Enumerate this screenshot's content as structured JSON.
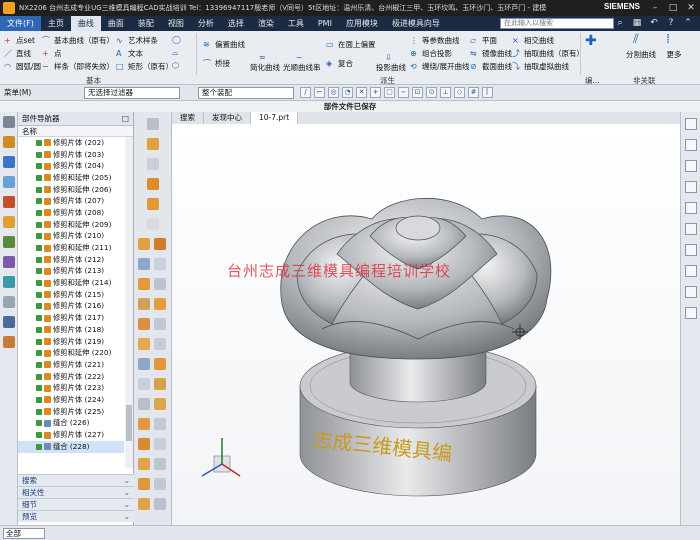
{
  "window": {
    "title": "NX2206 台州志成专业UG三维模具编程CAD实战培训 Tel：13396947117殷老师（V同号）5t区地址：温州乐清、台州椒江三甲、玉环坎鸣、玉环沙门、玉环芦门 - 建模",
    "brand": "SIEMENS"
  },
  "menu": {
    "tabs": [
      "文件(F)",
      "主页",
      "曲线",
      "曲面",
      "装配",
      "视图",
      "分析",
      "选择",
      "渲染",
      "工具",
      "PMI",
      "应用模块",
      "极进模具向导"
    ],
    "active_tab": "曲线",
    "search_placeholder": "在此输入以搜索"
  },
  "ribbon": {
    "basic": {
      "items": [
        "点set",
        "直线",
        "圆弧/圆",
        "基本曲线（原有）",
        "点",
        "样条（即将失效）",
        "艺术样条",
        "文本",
        "矩形（原有）"
      ],
      "label": "基本"
    },
    "derived": {
      "items": [
        "偏置曲线",
        "桥接",
        "简化曲线",
        "光顺曲线串",
        "在面上偏置",
        "复合",
        "投影曲线",
        "等参数曲线",
        "组合投影",
        "缠绕/展开曲线",
        "平面",
        "镜像曲线",
        "截面曲线",
        "相交曲线",
        "抽取曲线（原有）",
        "抽取虚拟曲线"
      ],
      "label": "派生"
    },
    "edit": {
      "items": [
        "分割曲线"
      ],
      "label": "编..."
    },
    "nonassoc": {
      "items": [
        "更多"
      ],
      "label": "非关联"
    }
  },
  "toolbar": {
    "menu_label": "菜单(M)",
    "filter_value": "无选择过滤器",
    "assembly_value": "整个装配"
  },
  "status_message": "部件文件已保存",
  "navigator": {
    "title": "部件导航器",
    "column": "名称",
    "rows": [
      "修剪片体 (202)",
      "修剪片体 (203)",
      "修剪片体 (204)",
      "修剪和延伸 (205)",
      "修剪和延伸 (206)",
      "修剪片体 (207)",
      "修剪片体 (208)",
      "修剪和延伸 (209)",
      "修剪片体 (210)",
      "修剪和延伸 (211)",
      "修剪片体 (212)",
      "修剪片体 (213)",
      "修剪和延伸 (214)",
      "修剪片体 (215)",
      "修剪片体 (216)",
      "修剪片体 (217)",
      "修剪片体 (218)",
      "修剪片体 (219)",
      "修剪和延伸 (220)",
      "修剪片体 (221)",
      "修剪片体 (222)",
      "修剪片体 (223)",
      "修剪片体 (224)",
      "修剪片体 (225)",
      "缝合 (226)",
      "修剪片体 (227)",
      "缝合 (228)"
    ],
    "panels": [
      "搜索",
      "相关性",
      "细节",
      "预览"
    ]
  },
  "graphics_tabs": [
    "搜索",
    "发现中心",
    "10-7.prt"
  ],
  "graphics_active_tab": "10-7.prt",
  "watermark": "台州志成三维模具编程培训学校",
  "engraving": "志成三维模具编",
  "bottom": {
    "scope_value": "全部"
  }
}
